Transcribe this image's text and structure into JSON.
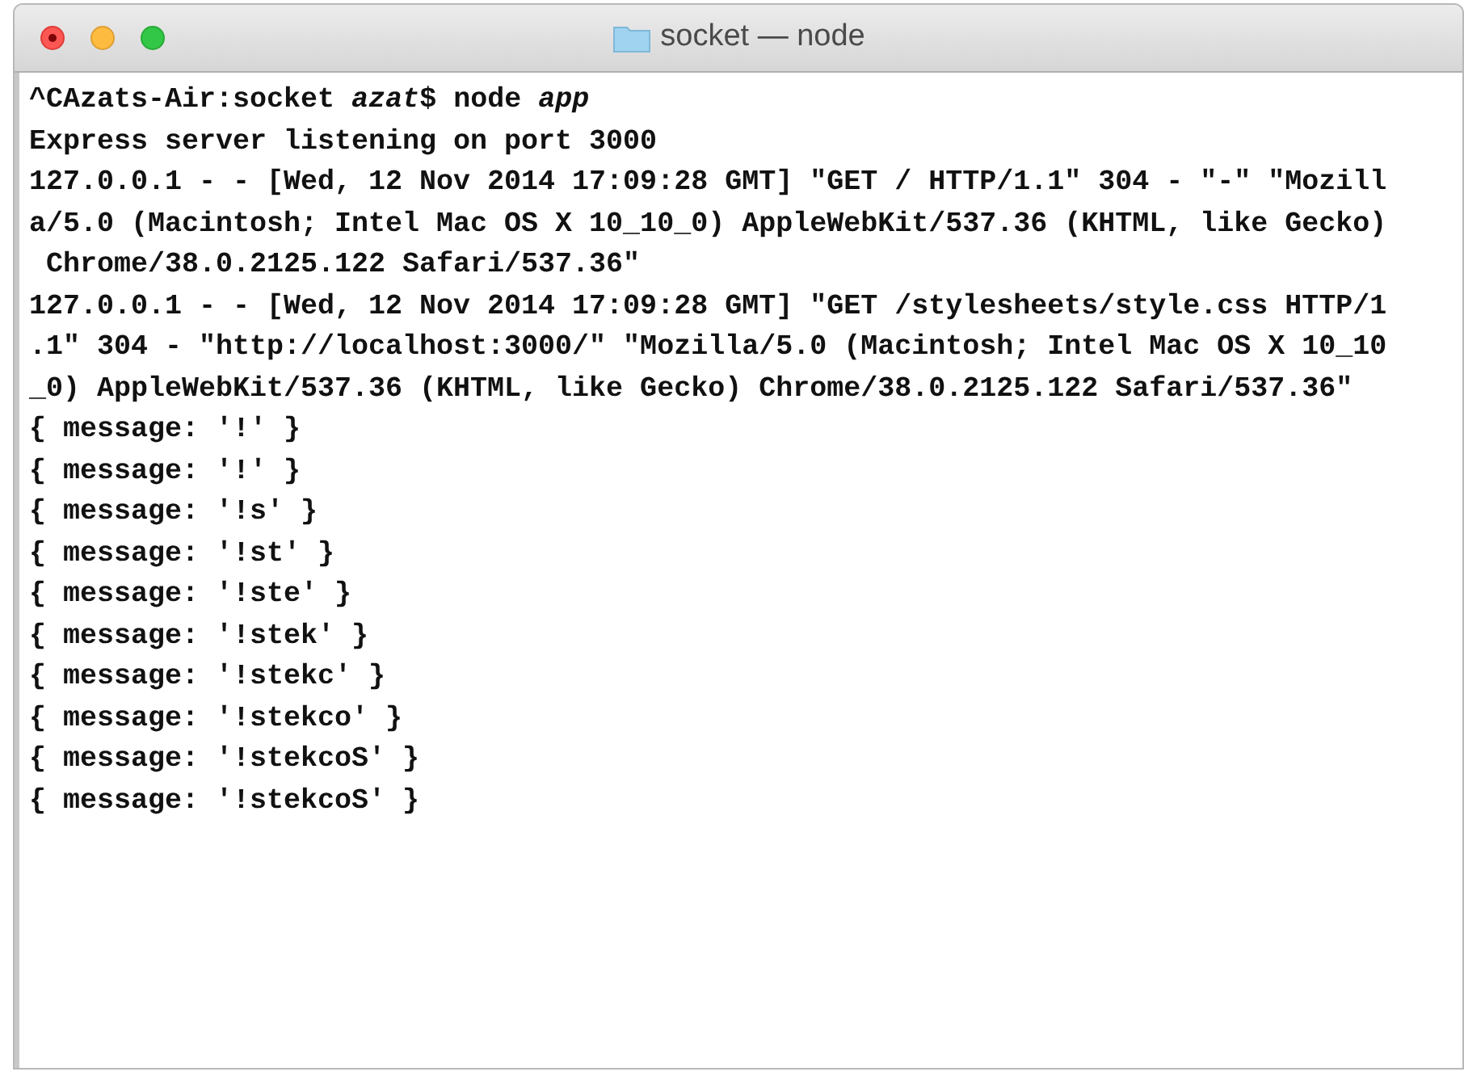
{
  "window": {
    "title": "socket — node"
  },
  "terminal": {
    "lines": [
      "^CAzats-Air:socket *azat*$ node *app*",
      "Express server listening on port 3000",
      "127.0.0.1 - - [Wed, 12 Nov 2014 17:09:28 GMT] \"GET / HTTP/1.1\" 304 - \"-\" \"Mozill",
      "a/5.0 (Macintosh; Intel Mac OS X 10_10_0) AppleWebKit/537.36 (KHTML, like Gecko)",
      " Chrome/38.0.2125.122 Safari/537.36\"",
      "127.0.0.1 - - [Wed, 12 Nov 2014 17:09:28 GMT] \"GET /stylesheets/style.css HTTP/1",
      ".1\" 304 - \"http://localhost:3000/\" \"Mozilla/5.0 (Macintosh; Intel Mac OS X 10_10",
      "_0) AppleWebKit/537.36 (KHTML, like Gecko) Chrome/38.0.2125.122 Safari/537.36\"",
      "{ message: '!' }",
      "{ message: '!' }",
      "{ message: '!s' }",
      "{ message: '!st' }",
      "{ message: '!ste' }",
      "{ message: '!stek' }",
      "{ message: '!stekc' }",
      "{ message: '!stekco' }",
      "{ message: '!stekcoS' }",
      "{ message: '!stekcoS' }"
    ]
  }
}
